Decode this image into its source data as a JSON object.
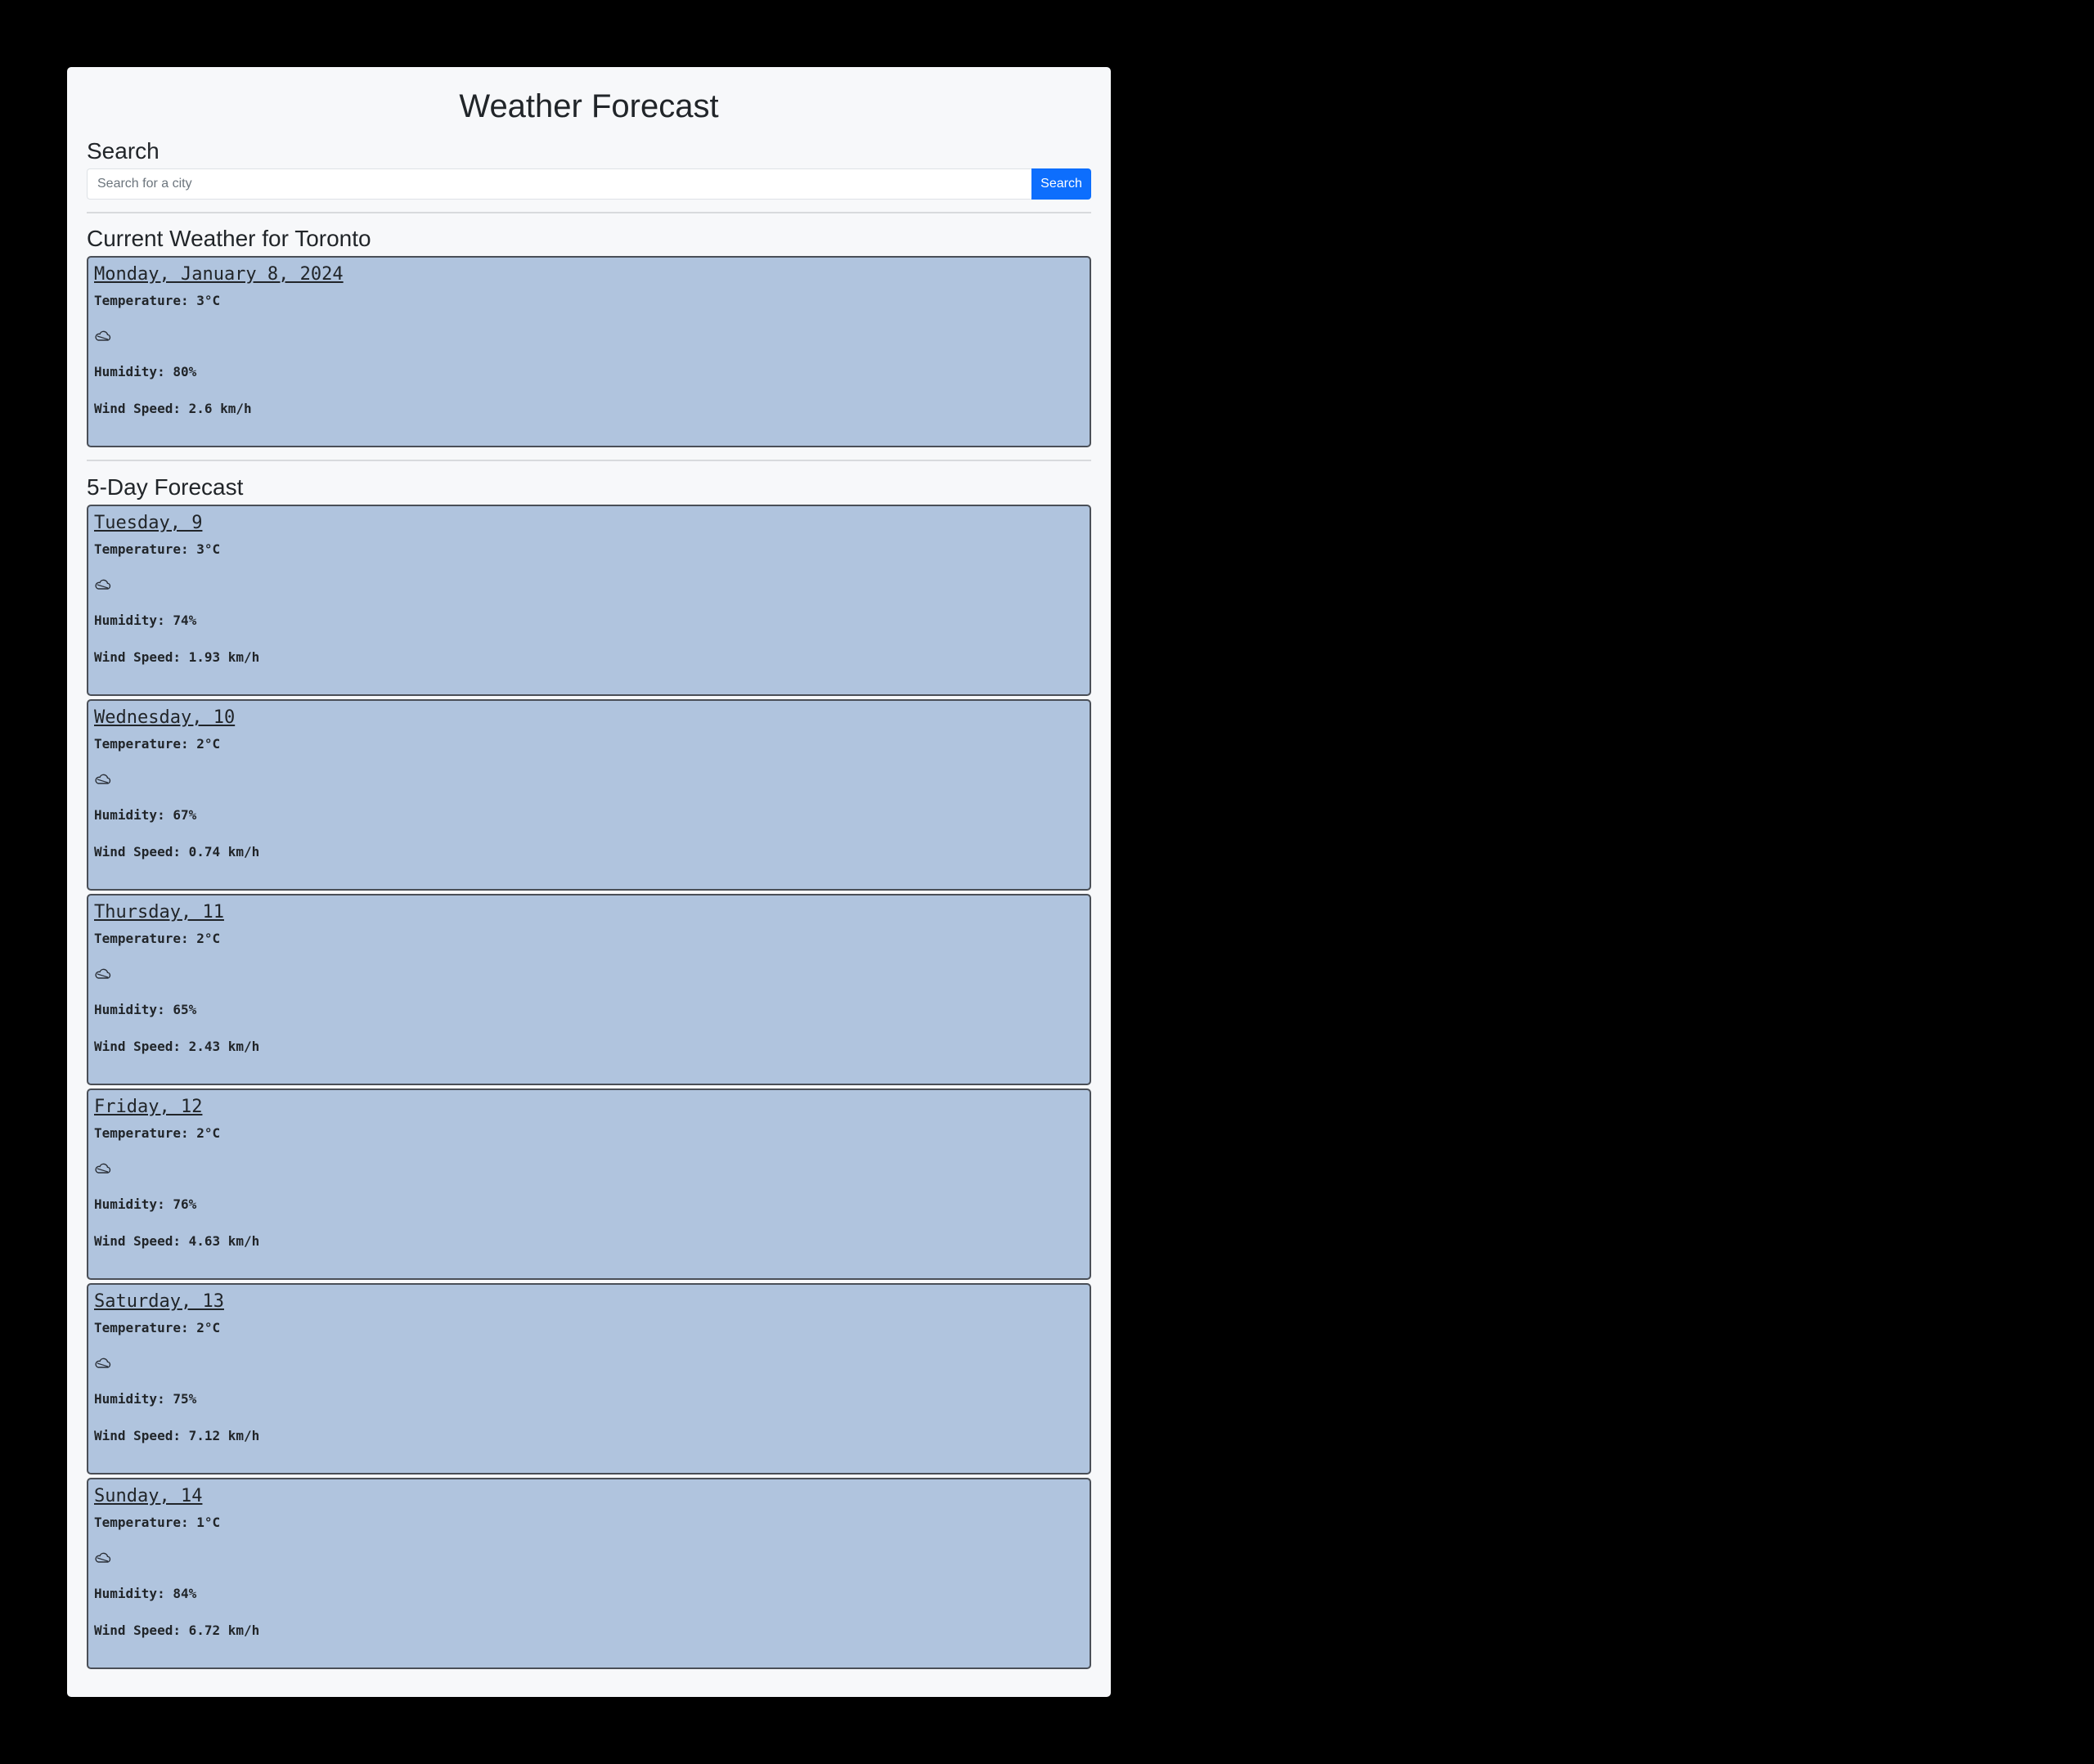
{
  "app": {
    "title": "Weather Forecast"
  },
  "search": {
    "heading": "Search",
    "placeholder": "Search for a city",
    "value": "",
    "button_label": "Search"
  },
  "current": {
    "heading": "Current Weather for Toronto",
    "date": "Monday, January 8, 2024",
    "temperature": "Temperature: 3°C",
    "icon": "cloud-icon",
    "humidity": "Humidity: 80%",
    "wind": "Wind Speed: 2.6 km/h"
  },
  "forecast": {
    "heading": "5-Day Forecast",
    "days": [
      {
        "date": "Tuesday, 9",
        "temperature": "Temperature: 3°C",
        "icon": "cloud-icon",
        "humidity": "Humidity: 74%",
        "wind": "Wind Speed: 1.93 km/h"
      },
      {
        "date": "Wednesday, 10",
        "temperature": "Temperature: 2°C",
        "icon": "cloud-icon",
        "humidity": "Humidity: 67%",
        "wind": "Wind Speed: 0.74 km/h"
      },
      {
        "date": "Thursday, 11",
        "temperature": "Temperature: 2°C",
        "icon": "cloud-icon",
        "humidity": "Humidity: 65%",
        "wind": "Wind Speed: 2.43 km/h"
      },
      {
        "date": "Friday, 12",
        "temperature": "Temperature: 2°C",
        "icon": "cloud-icon",
        "humidity": "Humidity: 76%",
        "wind": "Wind Speed: 4.63 km/h"
      },
      {
        "date": "Saturday, 13",
        "temperature": "Temperature: 2°C",
        "icon": "cloud-icon",
        "humidity": "Humidity: 75%",
        "wind": "Wind Speed: 7.12 km/h"
      },
      {
        "date": "Sunday, 14",
        "temperature": "Temperature: 1°C",
        "icon": "cloud-icon",
        "humidity": "Humidity: 84%",
        "wind": "Wind Speed: 6.72 km/h"
      }
    ]
  },
  "colors": {
    "page_background": "#000000",
    "panel_background": "#f7f8fa",
    "card_background": "#b0c4de",
    "card_border": "#4a4f57",
    "accent": "#0d6efd",
    "text": "#212529"
  }
}
